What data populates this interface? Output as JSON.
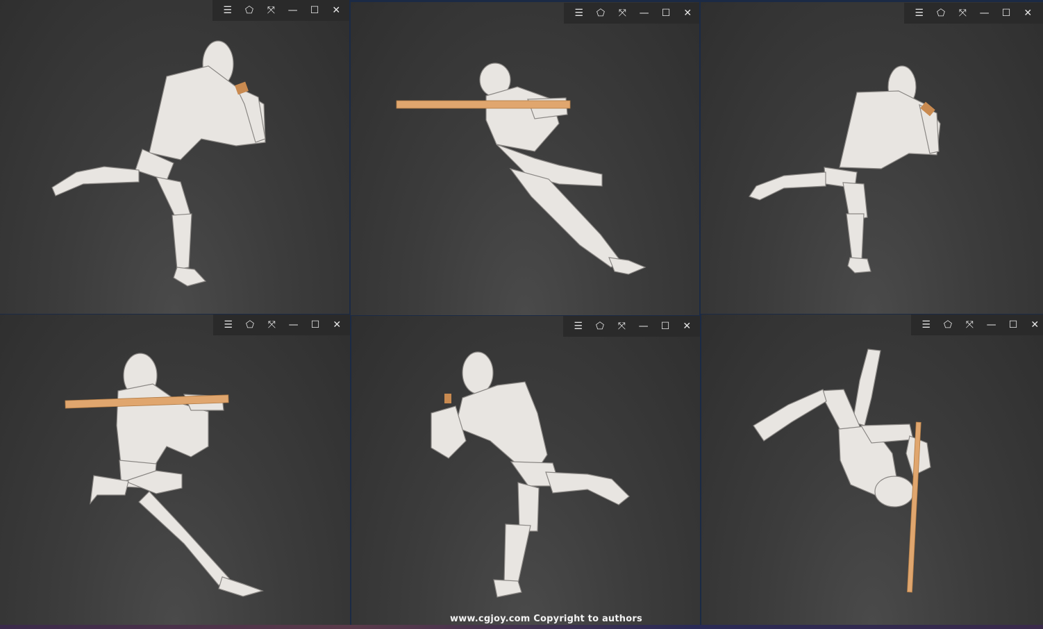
{
  "toolbar_icons": [
    "menu-icon",
    "shirt-icon",
    "fullscreen-icon",
    "minimize-icon",
    "maximize-icon",
    "close-icon"
  ],
  "toolbar_glyphs": {
    "menu": "☰",
    "shirt": "⬠",
    "fullscreen": "⤧",
    "minimize": "—",
    "maximize": "☐",
    "close": "✕"
  },
  "colors": {
    "viewport_bg": "#3c3c3c",
    "toolbar_bg": "#2a2a2a",
    "mannequin": "#e6e3df",
    "bat": "#d99a5c"
  },
  "viewports": [
    {
      "pose": "pitcher-windup"
    },
    {
      "pose": "batter-swing"
    },
    {
      "pose": "pitcher-windup"
    },
    {
      "pose": "batter-stance"
    },
    {
      "pose": "pitcher-stride"
    },
    {
      "pose": "fall-with-bat"
    }
  ],
  "watermark": "www.cgjoy.com Copyright to authors"
}
